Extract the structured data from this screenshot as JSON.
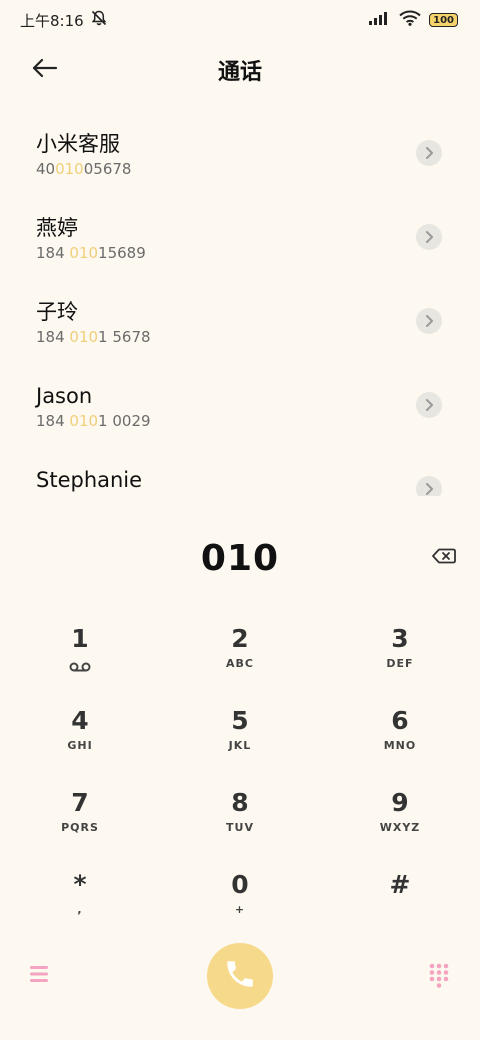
{
  "status_bar": {
    "time": "上午8:16",
    "battery": "100"
  },
  "header": {
    "title": "通话"
  },
  "contacts": [
    {
      "name": "小米客服",
      "number_pre": "40",
      "number_match": "010",
      "number_post": "05678"
    },
    {
      "name": "燕婷",
      "number_pre": "184 ",
      "number_match": "010",
      "number_post": "15689"
    },
    {
      "name": "子玲",
      "number_pre": "184 ",
      "number_match": "010",
      "number_post": "1 5678"
    },
    {
      "name": "Jason",
      "number_pre": "184 ",
      "number_match": "010",
      "number_post": "1 0029"
    },
    {
      "name": "Stephanie",
      "number_pre": "",
      "number_match": "",
      "number_post": ""
    }
  ],
  "dialer": {
    "number": "010"
  },
  "keypad": [
    {
      "digit": "1",
      "letters": ""
    },
    {
      "digit": "2",
      "letters": "ABC"
    },
    {
      "digit": "3",
      "letters": "DEF"
    },
    {
      "digit": "4",
      "letters": "GHI"
    },
    {
      "digit": "5",
      "letters": "JKL"
    },
    {
      "digit": "6",
      "letters": "MNO"
    },
    {
      "digit": "7",
      "letters": "PQRS"
    },
    {
      "digit": "8",
      "letters": "TUV"
    },
    {
      "digit": "9",
      "letters": "WXYZ"
    },
    {
      "digit": "*",
      "letters": ","
    },
    {
      "digit": "0",
      "letters": "+"
    },
    {
      "digit": "#",
      "letters": ""
    }
  ],
  "colors": {
    "background": "#fdf9f0",
    "highlight": "#f0cf7a",
    "call_button": "#f7d98b",
    "accent_pink": "#f4a3c0"
  },
  "icons": {
    "back": "arrow-left-icon",
    "mute": "bell-off-icon",
    "signal": "signal-icon",
    "wifi": "wifi-icon",
    "backspace": "backspace-icon",
    "voicemail": "voicemail-icon",
    "call": "phone-icon",
    "menu": "menu-icon",
    "keypad": "dialpad-icon"
  }
}
